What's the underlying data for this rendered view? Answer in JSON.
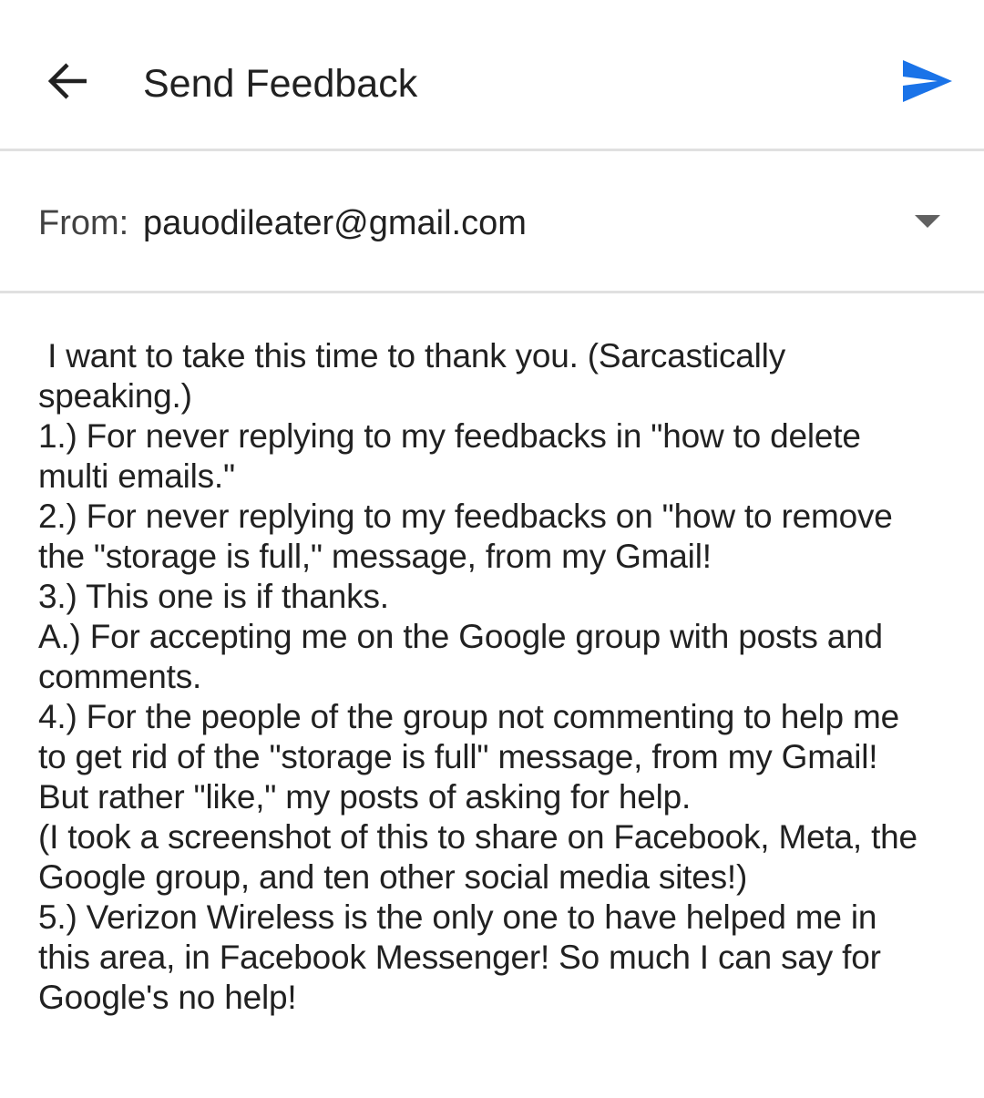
{
  "header": {
    "title": "Send Feedback",
    "back_icon": "arrow-back-icon",
    "send_icon": "send-icon",
    "accent_color": "#1a73e8"
  },
  "from": {
    "label": "From:",
    "email": "pauodileater@gmail.com",
    "dropdown_icon": "chevron-down-icon"
  },
  "body": {
    "lines": [
      " I want to take this time to thank you. (Sarcastically",
      "speaking.)",
      "1.) For never replying to my feedbacks in \"how to delete",
      "multi emails.\"",
      "2.) For never replying to my feedbacks on \"how to remove",
      "the \"storage is full,\" message, from my Gmail!",
      "3.) This one is if thanks.",
      "A.) For accepting me on the Google group with posts and",
      "comments.",
      "4.) For the people of the group not commenting to help me",
      "to get rid of the \"storage is full\" message, from my Gmail!",
      "But rather \"like,\" my posts of asking for help.",
      "(I took a screenshot of this to share on Facebook, Meta, the",
      "Google group, and ten other social media sites!)",
      "5.) Verizon Wireless is the only one to have helped me in",
      "this area, in Facebook Messenger! So much I can say for",
      "Google's no help!"
    ]
  }
}
